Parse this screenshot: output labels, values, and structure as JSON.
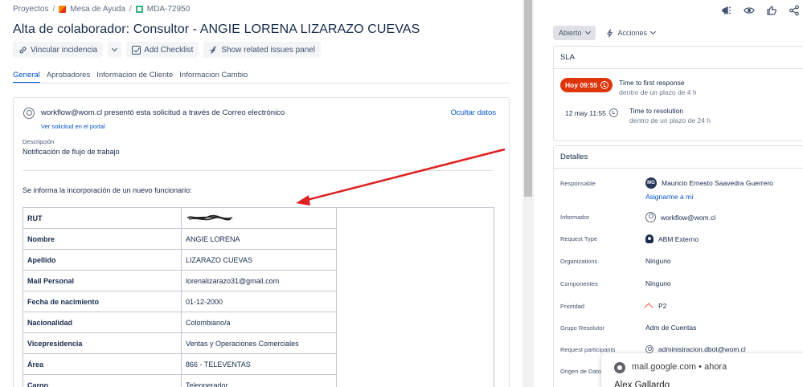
{
  "breadcrumb": {
    "projects": "Proyectos",
    "service_desk": "Mesa de Ayuda",
    "issue_key": "MDA-72950"
  },
  "issue": {
    "title": "Alta de colaborador: Consultor - ANGIE LORENA LIZARAZO CUEVAS"
  },
  "toolbar": {
    "link_issue": "Vincular incidencia",
    "add_checklist": "Add Checklist",
    "show_related": "Show related issues panel"
  },
  "tabs": [
    {
      "label": "General",
      "active": true
    },
    {
      "label": "Aprobadores"
    },
    {
      "label": "Informacion de Cliente"
    },
    {
      "label": "Informacion Cambio"
    }
  ],
  "request": {
    "sender_text": "workflow@wom.cl presentó esta solicitud a través de Correo electrónico",
    "portal_link": "Ver solicitud en el portal",
    "hide_data": "Ocultar datos",
    "description_label": "Descripción",
    "description": "Notificación de flujo de trabajo",
    "intro": "Se informa la incorporación de un nuevo funcionario:",
    "rows": [
      {
        "key": "RUT",
        "value": ""
      },
      {
        "key": "Nombre",
        "value": "ANGIE LORENA"
      },
      {
        "key": "Apellido",
        "value": "LIZARAZO CUEVAS"
      },
      {
        "key": "Mail Personal",
        "value": "lorenalizarazo31@gmail.com"
      },
      {
        "key": "Fecha de nacimiento",
        "value": "01-12-2000"
      },
      {
        "key": "Nacionalidad",
        "value": "Colombiano/a"
      },
      {
        "key": "Vicepresidencia",
        "value": "Ventas y Operaciones Comerciales"
      },
      {
        "key": "Área",
        "value": "866 - TELEVENTAS"
      },
      {
        "key": "Cargo",
        "value": "Teleoperador"
      }
    ]
  },
  "sidebar": {
    "status": "Abierto",
    "actions": "Acciones",
    "sla": {
      "title": "SLA",
      "first": {
        "badge": "Hoy 09:55",
        "label": "Time to first response",
        "sub": "dentro de un plazo de 4 h"
      },
      "resolution": {
        "date": "12 may 11:55",
        "label": "Time to resolution",
        "sub": "dentro de un plazo de 24 h"
      }
    },
    "details": {
      "title": "Detalles",
      "assign_me": "Asignarme a mí",
      "fields": [
        {
          "label": "Responsable",
          "value": "Mauricio Ernesto Saavedra Guerrero",
          "initials": "MG"
        },
        {
          "label": "Informador",
          "value": "workflow@wom.cl"
        },
        {
          "label": "Request Type",
          "value": "ABM Externo"
        },
        {
          "label": "Organizations",
          "value": "Ninguno"
        },
        {
          "label": "Componentes",
          "value": "Ninguno"
        },
        {
          "label": "Prioridad",
          "value": "P2"
        },
        {
          "label": "Grupo Resolutor",
          "value": "Adm de Cuentas"
        },
        {
          "label": "Request participants",
          "value": "administracion.dbot@wom.cl"
        },
        {
          "label": "Origen de Dato",
          "value": ""
        }
      ]
    }
  },
  "notification": {
    "source": "mail.google.com",
    "time": "ahora",
    "name": "Alex Gallardo"
  },
  "colors": {
    "accent": "#0052cc",
    "sla_breach": "#de350b",
    "arrow": "#e02020"
  }
}
